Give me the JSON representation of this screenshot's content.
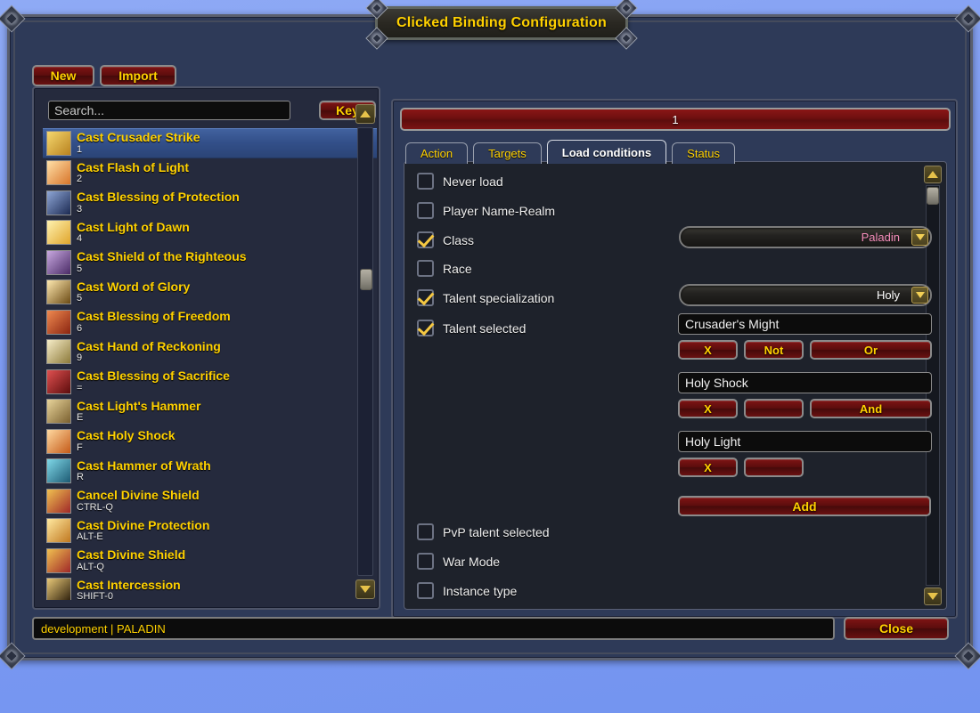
{
  "window": {
    "title": "Clicked Binding Configuration"
  },
  "toolbar": {
    "new_label": "New",
    "import_label": "Import"
  },
  "search": {
    "placeholder": "Search...",
    "value": "",
    "key_button_label": "Key"
  },
  "bindings": [
    {
      "title": "Cast Crusader Strike",
      "key": "1",
      "selected": true,
      "icon_colors": [
        "#f5d76e",
        "#b8821f"
      ]
    },
    {
      "title": "Cast Flash of Light",
      "key": "2",
      "selected": false,
      "icon_colors": [
        "#ffe0a8",
        "#d8752a"
      ]
    },
    {
      "title": "Cast Blessing of Protection",
      "key": "3",
      "selected": false,
      "icon_colors": [
        "#8ea6d6",
        "#1c2a52"
      ]
    },
    {
      "title": "Cast Light of Dawn",
      "key": "4",
      "selected": false,
      "icon_colors": [
        "#fff2b0",
        "#e0a52c"
      ]
    },
    {
      "title": "Cast Shield of the Righteous",
      "key": "5",
      "selected": false,
      "icon_colors": [
        "#c8a8e0",
        "#4a2b66"
      ]
    },
    {
      "title": "Cast Word of Glory",
      "key": "5",
      "selected": false,
      "icon_colors": [
        "#ffe9b0",
        "#6b4a14"
      ]
    },
    {
      "title": "Cast Blessing of Freedom",
      "key": "6",
      "selected": false,
      "icon_colors": [
        "#f08a50",
        "#8a2410"
      ]
    },
    {
      "title": "Cast Hand of Reckoning",
      "key": "9",
      "selected": false,
      "icon_colors": [
        "#f6edc8",
        "#8d7a3a"
      ]
    },
    {
      "title": "Cast Blessing of Sacrifice",
      "key": "=",
      "selected": false,
      "icon_colors": [
        "#e05050",
        "#5c0c0c"
      ]
    },
    {
      "title": "Cast Light's Hammer",
      "key": "E",
      "selected": false,
      "icon_colors": [
        "#e8d49a",
        "#7a6030"
      ]
    },
    {
      "title": "Cast Holy Shock",
      "key": "F",
      "selected": false,
      "icon_colors": [
        "#ffd9a0",
        "#c45a18"
      ]
    },
    {
      "title": "Cast Hammer of Wrath",
      "key": "R",
      "selected": false,
      "icon_colors": [
        "#7fd8e8",
        "#1d5a73"
      ]
    },
    {
      "title": "Cancel Divine Shield",
      "key": "CTRL-Q",
      "selected": false,
      "icon_colors": [
        "#f0c050",
        "#a02828"
      ]
    },
    {
      "title": "Cast Divine Protection",
      "key": "ALT-E",
      "selected": false,
      "icon_colors": [
        "#ffe9a0",
        "#c07820"
      ]
    },
    {
      "title": "Cast Divine Shield",
      "key": "ALT-Q",
      "selected": false,
      "icon_colors": [
        "#f0c050",
        "#a02828"
      ]
    },
    {
      "title": "Cast Intercession",
      "key": "SHIFT-0",
      "selected": false,
      "icon_colors": [
        "#e8c878",
        "#2a1c0a"
      ]
    }
  ],
  "detail": {
    "binding_name": "1",
    "tabs": [
      {
        "label": "Action",
        "active": false
      },
      {
        "label": "Targets",
        "active": false
      },
      {
        "label": "Load conditions",
        "active": true
      },
      {
        "label": "Status",
        "active": false
      }
    ],
    "conditions": [
      {
        "label": "Never load",
        "checked": false
      },
      {
        "label": "Player Name-Realm",
        "checked": false
      },
      {
        "label": "Class",
        "checked": true
      },
      {
        "label": "Race",
        "checked": false
      },
      {
        "label": "Talent specialization",
        "checked": true
      },
      {
        "label": "Talent selected",
        "checked": true
      },
      {
        "label": "PvP talent selected",
        "checked": false
      },
      {
        "label": "War Mode",
        "checked": false
      },
      {
        "label": "Instance type",
        "checked": false
      }
    ],
    "class_dropdown": {
      "value": "Paladin",
      "color": "#F58CBA"
    },
    "spec_dropdown": {
      "value": "Holy",
      "color": "#FFFFFF"
    },
    "talent_rows": [
      {
        "value": "Crusader's Might",
        "remove_label": "X",
        "negate_label": "Not",
        "conjunction_label": "Or"
      },
      {
        "value": "Holy Shock",
        "remove_label": "X",
        "negate_label": "",
        "conjunction_label": "And"
      },
      {
        "value": "Holy Light",
        "remove_label": "X",
        "negate_label": "",
        "conjunction_label": ""
      }
    ],
    "add_button_label": "Add"
  },
  "footer": {
    "status_text": "development | PALADIN",
    "close_label": "Close"
  },
  "colors": {
    "accent_gold": "#FFD100",
    "button_red": "#6e1010",
    "paladin_pink": "#F58CBA",
    "panel_dark": "#1E222B",
    "panel_blue": "#2E3A58",
    "list_bg": "#252A3D"
  }
}
